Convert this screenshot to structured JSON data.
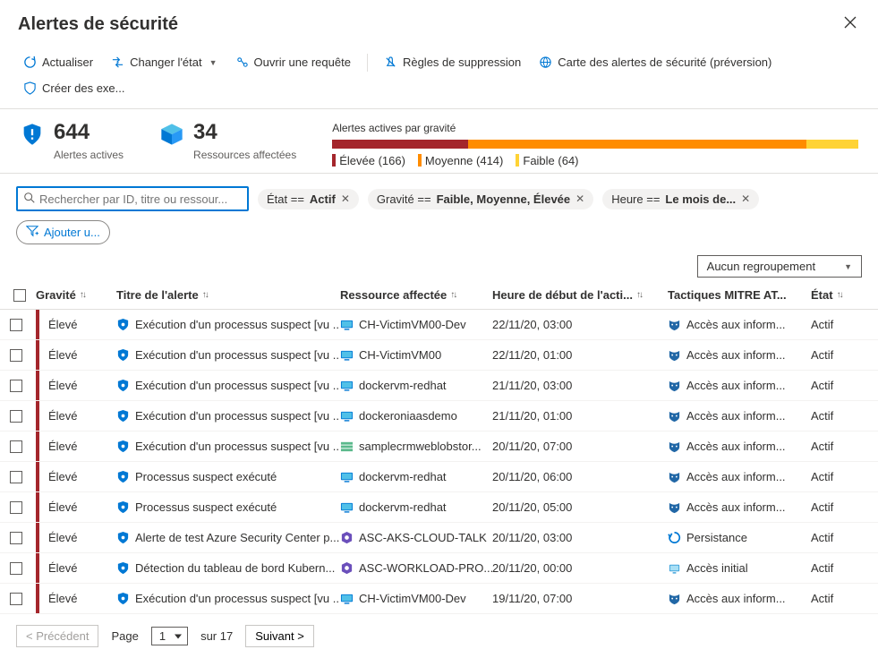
{
  "title": "Alertes de sécurité",
  "toolbar": {
    "refresh": "Actualiser",
    "change_state": "Changer l'état",
    "open_query": "Ouvrir une requête",
    "suppression": "Règles de suppression",
    "map": "Carte des alertes de sécurité (préversion)",
    "create": "Créer des exe..."
  },
  "metrics": {
    "active_count": "644",
    "active_label": "Alertes actives",
    "resources_count": "34",
    "resources_label": "Ressources affectées",
    "severity_title": "Alertes actives par gravité",
    "high": "Élevée (166)",
    "med": "Moyenne (414)",
    "low": "Faible (64)"
  },
  "filters": {
    "search_placeholder": "Rechercher par ID, titre ou ressour...",
    "state_key": "État == ",
    "state_val": "Actif",
    "sev_key": "Gravité == ",
    "sev_val": "Faible, Moyenne, Élevée",
    "time_key": "Heure == ",
    "time_val": "Le mois de...",
    "add": "Ajouter u..."
  },
  "grouping": "Aucun regroupement",
  "columns": {
    "sev": "Gravité",
    "title": "Titre de l'alerte",
    "res": "Ressource affectée",
    "time": "Heure de début de l'acti...",
    "tac": "Tactiques MITRE AT...",
    "state": "État"
  },
  "rows": [
    {
      "sev": "Élevé",
      "title": "Exécution d'un processus suspect [vu ...",
      "res": "CH-VictimVM00-Dev",
      "rtype": "vm",
      "time": "22/11/20, 03:00",
      "tac": "Accès aux inform...",
      "ticon": "mask",
      "state": "Actif"
    },
    {
      "sev": "Élevé",
      "title": "Exécution d'un processus suspect [vu ...",
      "res": "CH-VictimVM00",
      "rtype": "vm",
      "time": "22/11/20, 01:00",
      "tac": "Accès aux inform...",
      "ticon": "mask",
      "state": "Actif"
    },
    {
      "sev": "Élevé",
      "title": "Exécution d'un processus suspect [vu ...",
      "res": "dockervm-redhat",
      "rtype": "vm",
      "time": "21/11/20, 03:00",
      "tac": "Accès aux inform...",
      "ticon": "mask",
      "state": "Actif"
    },
    {
      "sev": "Élevé",
      "title": "Exécution d'un processus suspect [vu ...",
      "res": "dockeroniaasdemo",
      "rtype": "vm",
      "time": "21/11/20, 01:00",
      "tac": "Accès aux inform...",
      "ticon": "mask",
      "state": "Actif"
    },
    {
      "sev": "Élevé",
      "title": "Exécution d'un processus suspect [vu ...",
      "res": "samplecrmweblobstor...",
      "rtype": "storage",
      "time": "20/11/20, 07:00",
      "tac": "Accès aux inform...",
      "ticon": "mask",
      "state": "Actif"
    },
    {
      "sev": "Élevé",
      "title": "Processus suspect exécuté",
      "res": "dockervm-redhat",
      "rtype": "vm",
      "time": "20/11/20, 06:00",
      "tac": "Accès aux inform...",
      "ticon": "mask",
      "state": "Actif"
    },
    {
      "sev": "Élevé",
      "title": "Processus suspect exécuté",
      "res": "dockervm-redhat",
      "rtype": "vm",
      "time": "20/11/20, 05:00",
      "tac": "Accès aux inform...",
      "ticon": "mask",
      "state": "Actif"
    },
    {
      "sev": "Élevé",
      "title": "Alerte de test Azure Security Center p...",
      "res": "ASC-AKS-CLOUD-TALK",
      "rtype": "aks",
      "time": "20/11/20, 03:00",
      "tac": "Persistance",
      "ticon": "persist",
      "state": "Actif"
    },
    {
      "sev": "Élevé",
      "title": "Détection du tableau de bord Kubern...",
      "res": "ASC-WORKLOAD-PRO...",
      "rtype": "aks",
      "time": "20/11/20, 00:00",
      "tac": "Accès initial",
      "ticon": "initial",
      "state": "Actif"
    },
    {
      "sev": "Élevé",
      "title": "Exécution d'un processus suspect [vu ...",
      "res": "CH-VictimVM00-Dev",
      "rtype": "vm",
      "time": "19/11/20, 07:00",
      "tac": "Accès aux inform...",
      "ticon": "mask",
      "state": "Actif"
    }
  ],
  "pager": {
    "prev": "< Précédent",
    "page_label": "Page",
    "page": "1",
    "of": "sur 17",
    "next": "Suivant >"
  }
}
